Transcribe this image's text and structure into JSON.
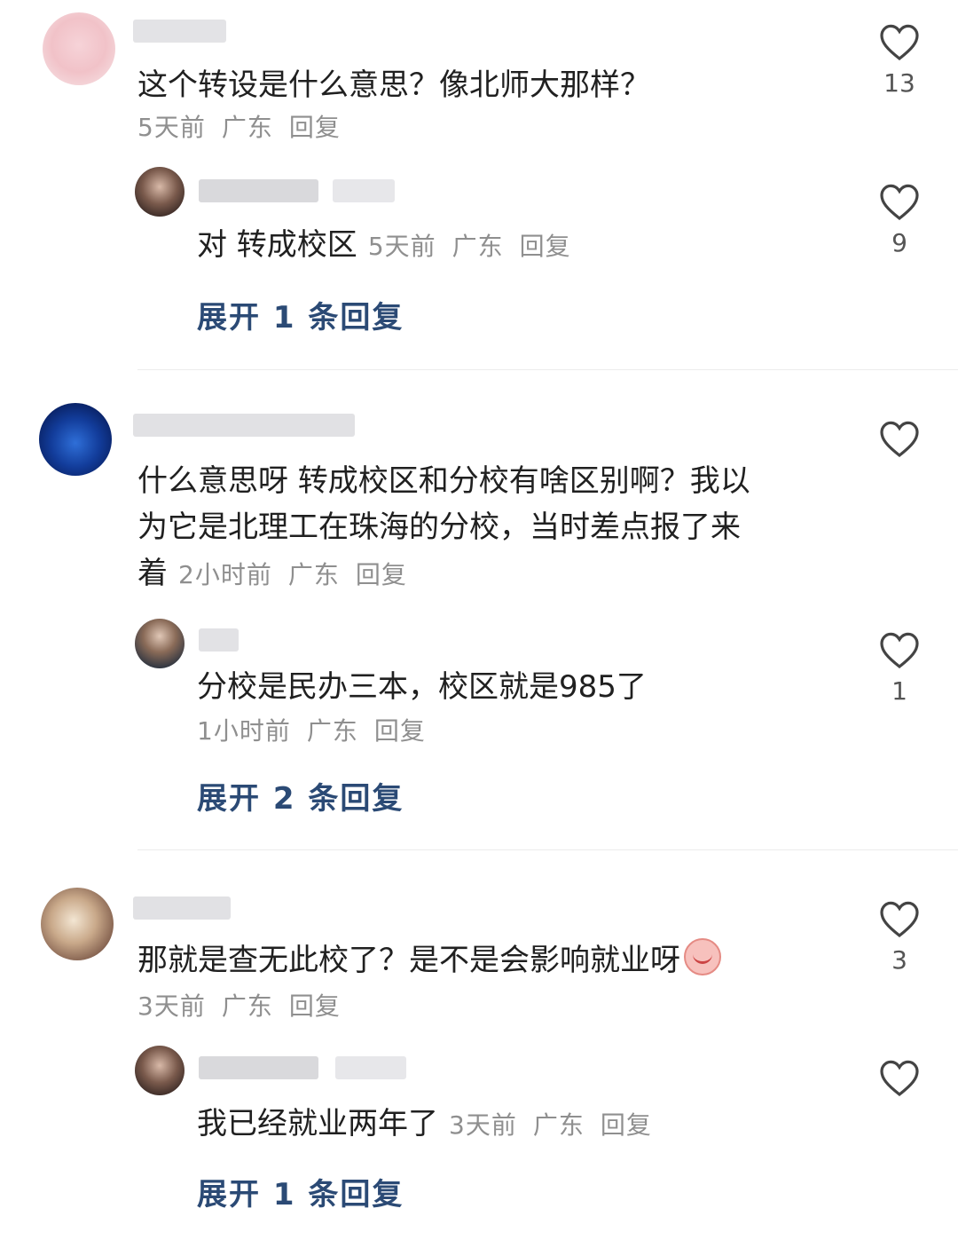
{
  "comments": [
    {
      "text": "这个转设是什么意思？像北师大那样？",
      "meta": {
        "time": "5天前",
        "location": "广东",
        "reply": "回复"
      },
      "likes": "13",
      "reply": {
        "text": "对 转成校区",
        "meta": {
          "time": "5天前",
          "location": "广东",
          "reply": "回复"
        },
        "likes": "9"
      },
      "expand": "展开 1 条回复"
    },
    {
      "text_lines": [
        "什么意思呀 转成校区和分校有啥区别啊？我以",
        "为它是北理工在珠海的分校，当时差点报了来",
        "着"
      ],
      "meta": {
        "time": "2小时前",
        "location": "广东",
        "reply": "回复"
      },
      "likes": "",
      "reply": {
        "text": "分校是民办三本，校区就是985了",
        "meta": {
          "time": "1小时前",
          "location": "广东",
          "reply": "回复"
        },
        "likes": "1"
      },
      "expand": "展开 2 条回复"
    },
    {
      "text": "那就是查无此校了？是不是会影响就业呀",
      "emoji_icon": "crying-face-emoji",
      "meta": {
        "time": "3天前",
        "location": "广东",
        "reply": "回复"
      },
      "likes": "3",
      "reply": {
        "text": "我已经就业两年了",
        "meta": {
          "time": "3天前",
          "location": "广东",
          "reply": "回复"
        },
        "likes": ""
      },
      "expand": "展开 1 条回复"
    }
  ],
  "colors": {
    "link": "#2b4a75",
    "meta": "#8f8f8f",
    "text": "#202020"
  }
}
